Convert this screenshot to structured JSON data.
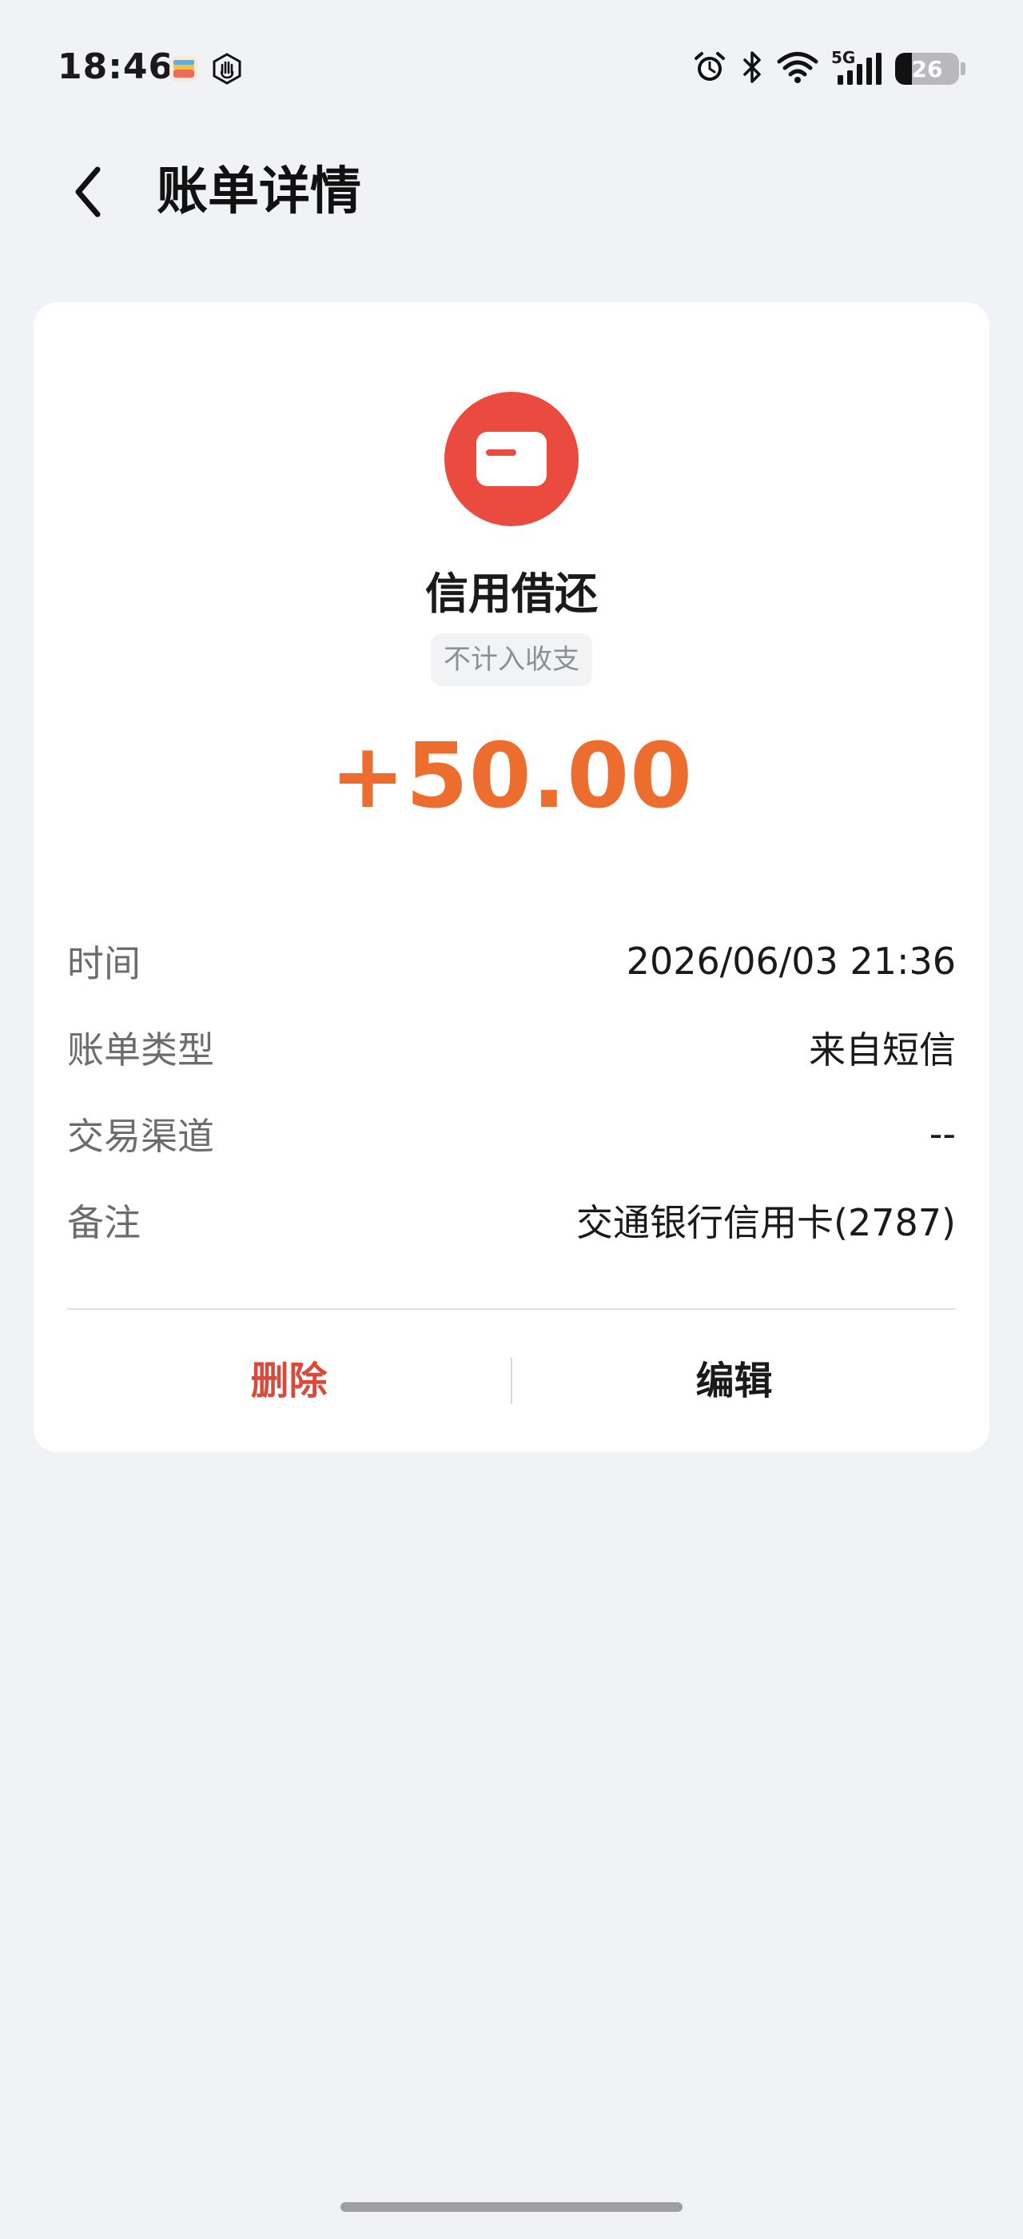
{
  "status_bar": {
    "time": "18:46",
    "network": "5G",
    "battery_level": "26",
    "battery_percent": 26,
    "icons": [
      "wallet-app-icon",
      "hand-icon",
      "alarm-icon",
      "bluetooth-icon",
      "wifi-icon",
      "signal-icon",
      "battery-icon"
    ]
  },
  "header": {
    "title": "账单详情",
    "back_icon": "chevron-left-icon"
  },
  "bill": {
    "category_icon": "card-icon",
    "category": "信用借还",
    "tag": "不计入收支",
    "amount": "+50.00",
    "amount_color": "#ec6d2e",
    "icon_color": "#eb4b3f",
    "details": [
      {
        "label": "时间",
        "value": "2026/06/03 21:36"
      },
      {
        "label": "账单类型",
        "value": "来自短信"
      },
      {
        "label": "交易渠道",
        "value": "--"
      },
      {
        "label": "备注",
        "value": "交通银行信用卡(2787)"
      }
    ]
  },
  "actions": {
    "delete_label": "删除",
    "edit_label": "编辑",
    "delete_color": "#d94a3c"
  }
}
